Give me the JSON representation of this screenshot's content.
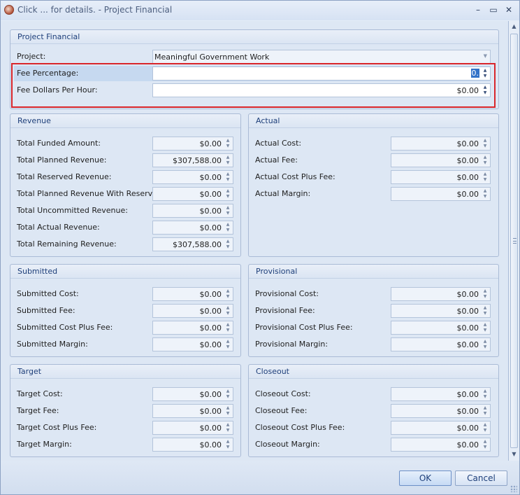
{
  "window": {
    "title": "Click ... for details. - Project Financial",
    "controls": {
      "minimize": "–",
      "maximize": "▭",
      "close": "✕"
    }
  },
  "project_financial": {
    "heading": "Project Financial",
    "project_label": "Project:",
    "project_value": "Meaningful Government Work",
    "fee_percentage_label": "Fee Percentage:",
    "fee_percentage_value": "0.",
    "fee_dollars_label": "Fee Dollars Per Hour:",
    "fee_dollars_value": "$0.00"
  },
  "revenue": {
    "heading": "Revenue",
    "rows": [
      {
        "label": "Total Funded Amount:",
        "value": "$0.00"
      },
      {
        "label": "Total Planned Revenue:",
        "value": "$307,588.00"
      },
      {
        "label": "Total Reserved Revenue:",
        "value": "$0.00"
      },
      {
        "label": "Total Planned Revenue With Reserves:",
        "value": "$0.00"
      },
      {
        "label": "Total Uncommitted Revenue:",
        "value": "$0.00"
      },
      {
        "label": "Total Actual Revenue:",
        "value": "$0.00"
      },
      {
        "label": "Total Remaining Revenue:",
        "value": "$307,588.00"
      }
    ]
  },
  "actual": {
    "heading": "Actual",
    "rows": [
      {
        "label": "Actual Cost:",
        "value": "$0.00"
      },
      {
        "label": "Actual Fee:",
        "value": "$0.00"
      },
      {
        "label": "Actual Cost Plus Fee:",
        "value": "$0.00"
      },
      {
        "label": "Actual Margin:",
        "value": "$0.00"
      }
    ]
  },
  "submitted": {
    "heading": "Submitted",
    "rows": [
      {
        "label": "Submitted Cost:",
        "value": "$0.00"
      },
      {
        "label": "Submitted Fee:",
        "value": "$0.00"
      },
      {
        "label": "Submitted Cost Plus Fee:",
        "value": "$0.00"
      },
      {
        "label": "Submitted Margin:",
        "value": "$0.00"
      }
    ]
  },
  "provisional": {
    "heading": "Provisional",
    "rows": [
      {
        "label": "Provisional Cost:",
        "value": "$0.00"
      },
      {
        "label": "Provisional Fee:",
        "value": "$0.00"
      },
      {
        "label": "Provisional Cost Plus Fee:",
        "value": "$0.00"
      },
      {
        "label": "Provisional Margin:",
        "value": "$0.00"
      }
    ]
  },
  "target": {
    "heading": "Target",
    "rows": [
      {
        "label": "Target Cost:",
        "value": "$0.00"
      },
      {
        "label": "Target Fee:",
        "value": "$0.00"
      },
      {
        "label": "Target Cost Plus Fee:",
        "value": "$0.00"
      },
      {
        "label": "Target Margin:",
        "value": "$0.00"
      }
    ]
  },
  "closeout": {
    "heading": "Closeout",
    "rows": [
      {
        "label": "Closeout Cost:",
        "value": "$0.00"
      },
      {
        "label": "Closeout Fee:",
        "value": "$0.00"
      },
      {
        "label": "Closeout Cost Plus Fee:",
        "value": "$0.00"
      },
      {
        "label": "Closeout Margin:",
        "value": "$0.00"
      }
    ]
  },
  "footer": {
    "ok_label": "OK",
    "cancel_label": "Cancel"
  },
  "colors": {
    "highlight_border": "#d9262b",
    "selection": "#3272c8",
    "heading_text": "#1e3f7a"
  }
}
